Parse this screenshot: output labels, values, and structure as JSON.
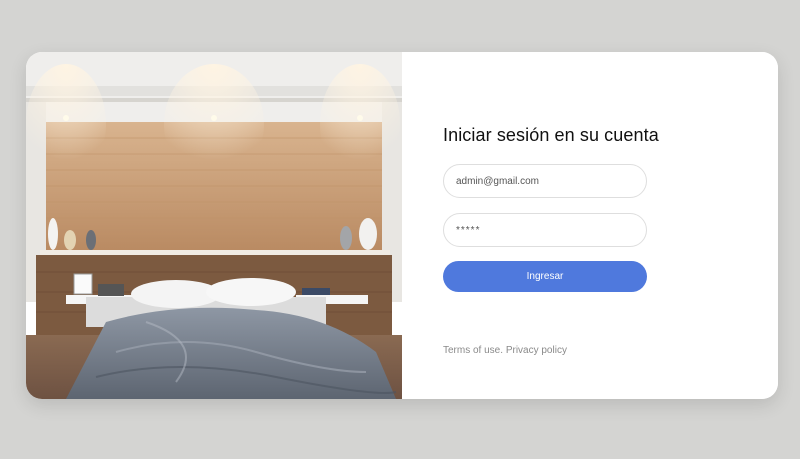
{
  "photo": {
    "image_name": "bedroom-photo"
  },
  "login": {
    "title": "Iniciar sesión en su cuenta",
    "email_value": "admin@gmail.com",
    "password_value": "*****",
    "submit_label": "Ingresar",
    "terms_label": "Terms of use.",
    "privacy_label": "Privacy policy"
  },
  "colors": {
    "accent": "#4f79dd",
    "background": "#d4d4d2",
    "card": "#ffffff",
    "muted_text": "#8a8a8a"
  }
}
